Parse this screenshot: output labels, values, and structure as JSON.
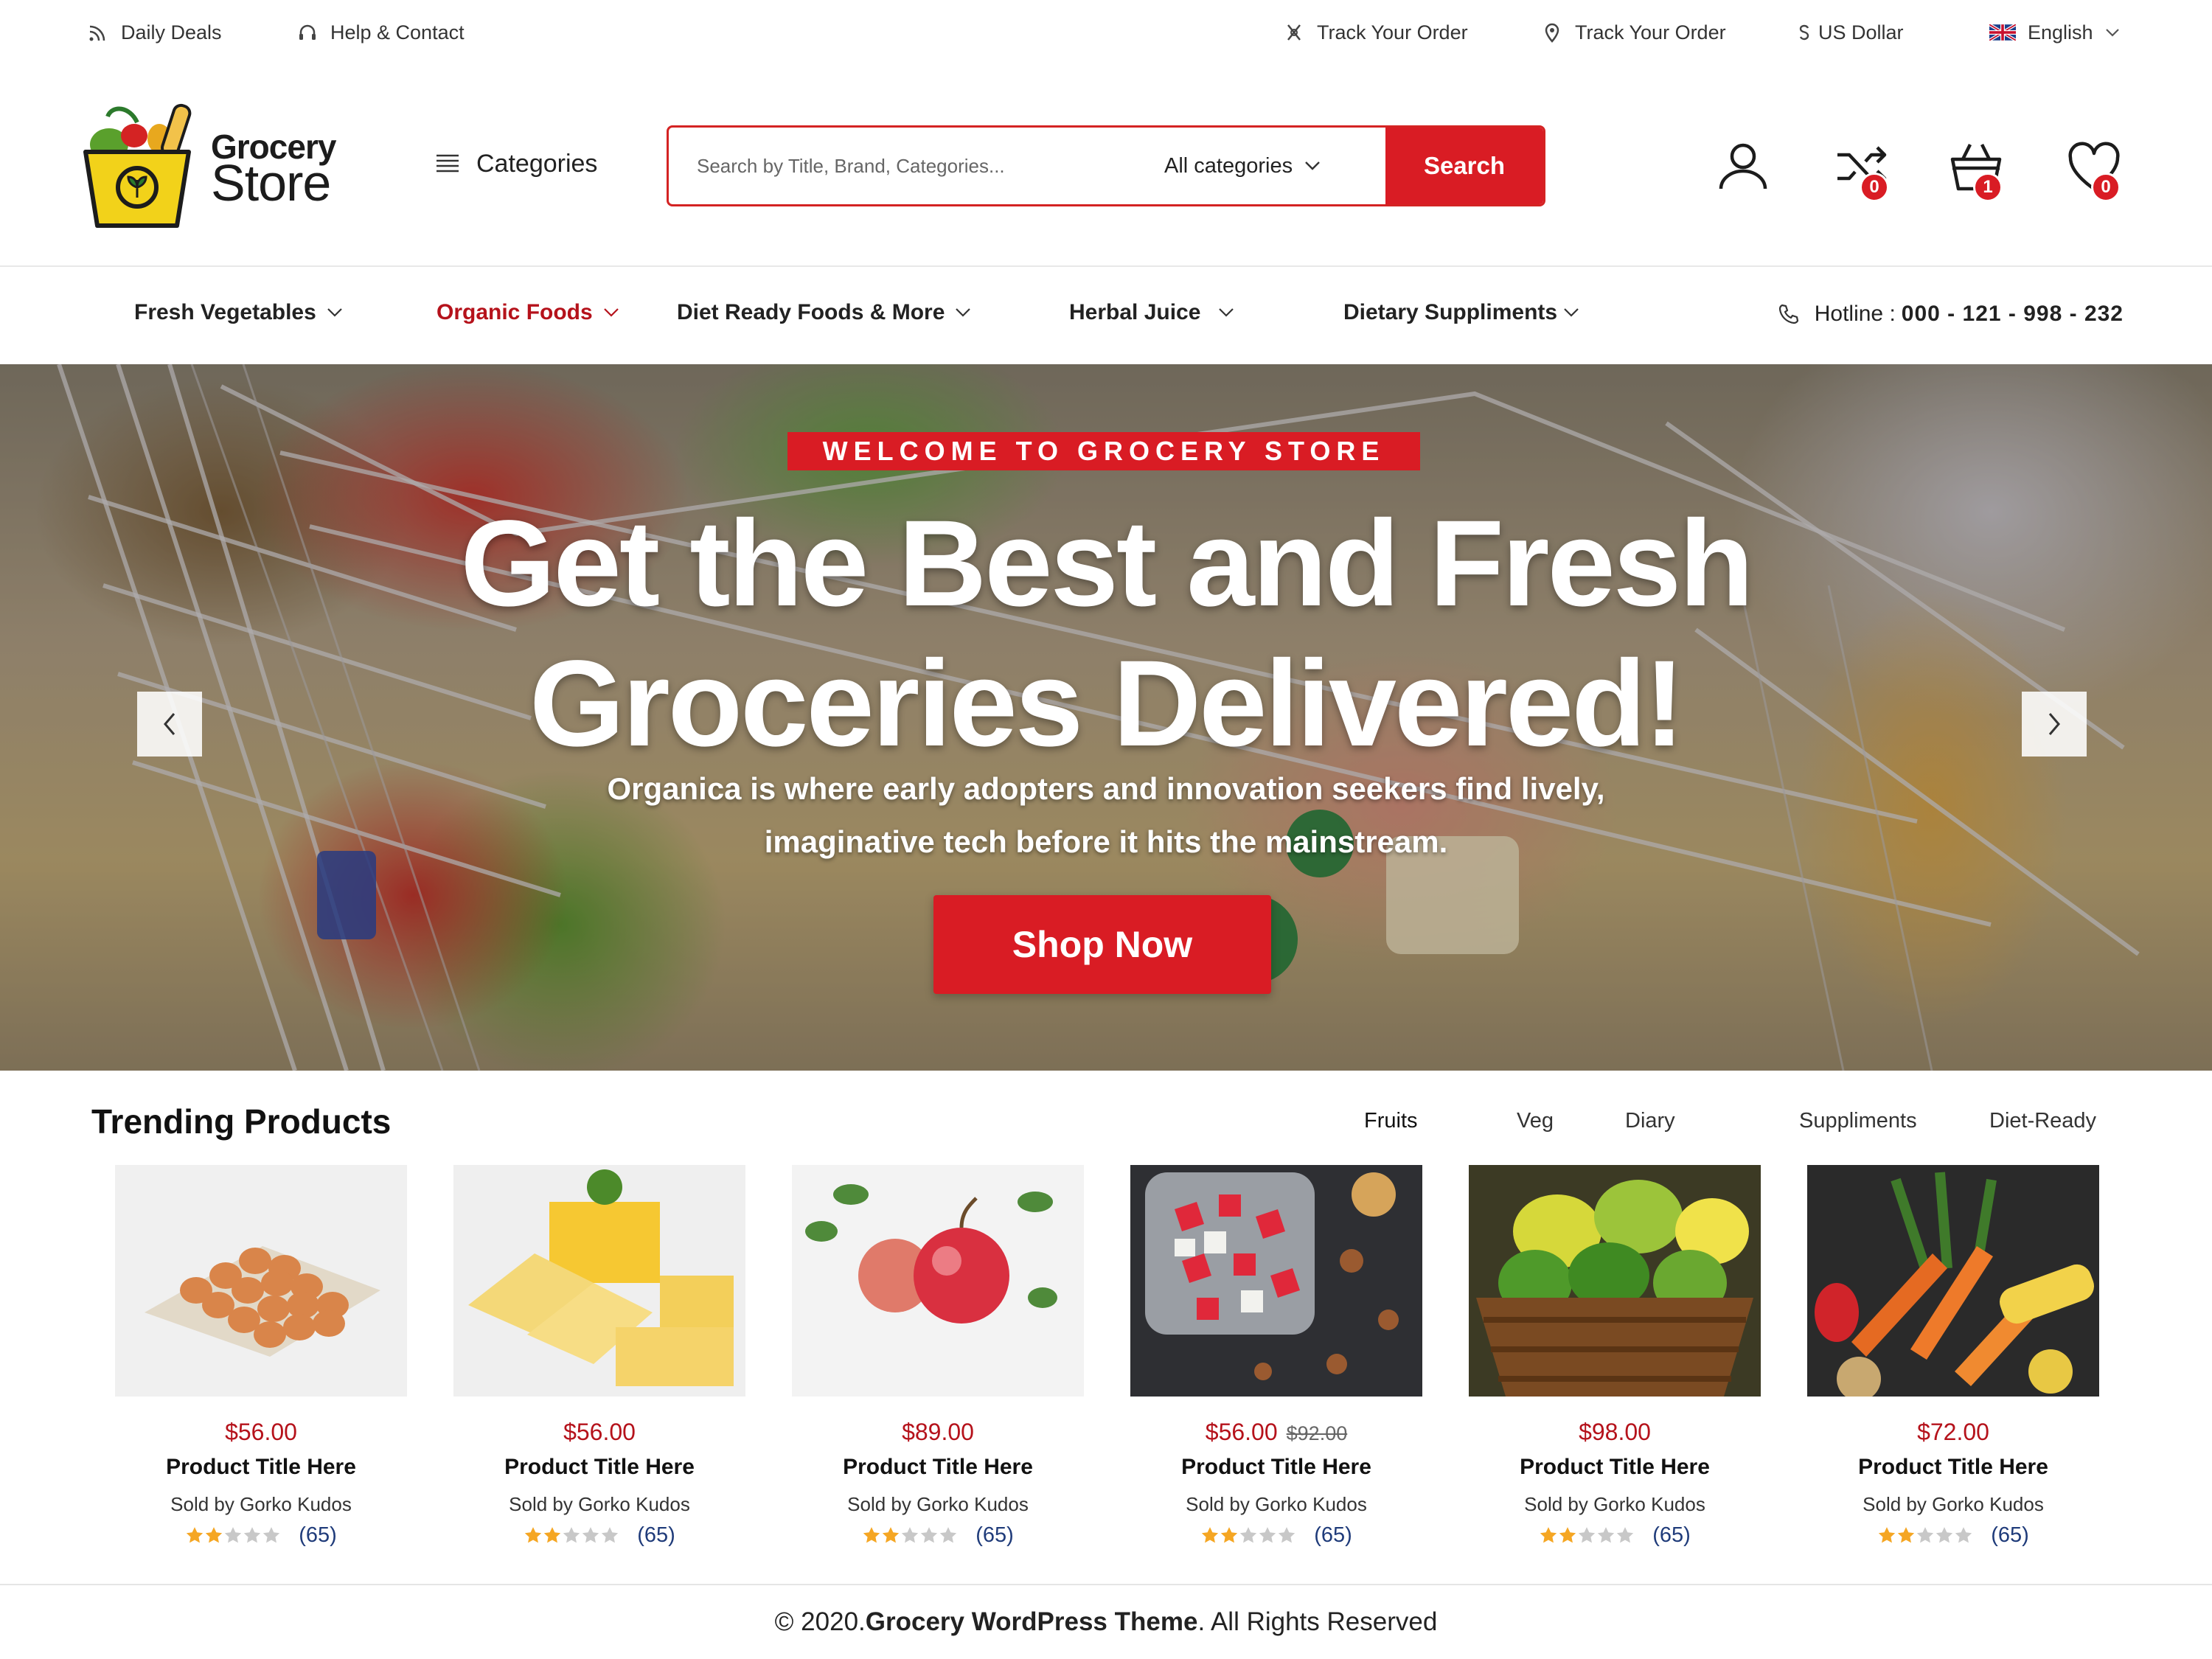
{
  "topbar": {
    "daily_deals": "Daily Deals",
    "help_contact": "Help & Contact",
    "track_order_1": "Track Your Order",
    "track_order_2": "Track Your Order",
    "currency": "US Dollar",
    "language": "English"
  },
  "logo": {
    "line1": "Grocery",
    "line2": "Store"
  },
  "header": {
    "categories_label": "Categories",
    "search_placeholder": "Search by Title, Brand, Categories...",
    "search_category": "All categories",
    "search_button": "Search",
    "compare_count": "0",
    "cart_count": "1",
    "wishlist_count": "0"
  },
  "nav": {
    "items": [
      {
        "label": "Fresh Vegetables"
      },
      {
        "label": "Organic Foods"
      },
      {
        "label": "Diet Ready Foods & More"
      },
      {
        "label": "Herbal Juice"
      },
      {
        "label": "Dietary Suppliments"
      }
    ],
    "active_index": 1,
    "hotline_label": "Hotline :",
    "hotline_number": "000 - 121 - 998 - 232"
  },
  "hero": {
    "badge": "WELCOME TO GROCERY STORE",
    "title_line1": "Get the Best and Fresh",
    "title_line2": "Groceries Delivered!",
    "subtitle_line1": "Organica is where early adopters and innovation seekers find lively,",
    "subtitle_line2": "imaginative tech before it hits the mainstream.",
    "cta": "Shop Now"
  },
  "trending": {
    "title": "Trending Products",
    "tabs": [
      "Fruits",
      "Veg",
      "Diary",
      "Suppliments",
      "Diet-Ready"
    ],
    "active_tab": "Fruits",
    "products": [
      {
        "image": "eggs-image",
        "price": "$56.00",
        "old_price": "",
        "title": "Product Title Here",
        "seller": "Sold by Gorko Kudos",
        "rating": 2,
        "reviews": "(65)"
      },
      {
        "image": "butter-image",
        "price": "$56.00",
        "old_price": "",
        "title": "Product Title Here",
        "seller": "Sold by Gorko Kudos",
        "rating": 2,
        "reviews": "(65)"
      },
      {
        "image": "apples-image",
        "price": "$89.00",
        "old_price": "",
        "title": "Product Title Here",
        "seller": "Sold by Gorko Kudos",
        "rating": 2,
        "reviews": "(65)"
      },
      {
        "image": "fruit-salad-image",
        "price": "$56.00",
        "old_price": "$92.00",
        "title": "Product Title Here",
        "seller": "Sold by Gorko Kudos",
        "rating": 2,
        "reviews": "(65)"
      },
      {
        "image": "peppers-basket-image",
        "price": "$98.00",
        "old_price": "",
        "title": "Product Title Here",
        "seller": "Sold by Gorko Kudos",
        "rating": 2,
        "reviews": "(65)"
      },
      {
        "image": "vegetables-image",
        "price": "$72.00",
        "old_price": "",
        "title": "Product Title Here",
        "seller": "Sold by Gorko Kudos",
        "rating": 2,
        "reviews": "(65)"
      }
    ]
  },
  "footer": {
    "prefix": "© 2020. ",
    "brand": "Grocery WordPress Theme",
    "suffix": ". All Rights Reserved"
  },
  "colors": {
    "accent": "#d91c24",
    "active_nav": "#b5121b",
    "star": "#f5a623",
    "star_empty": "#c8c8c8",
    "review_count": "#1f3b7a"
  }
}
